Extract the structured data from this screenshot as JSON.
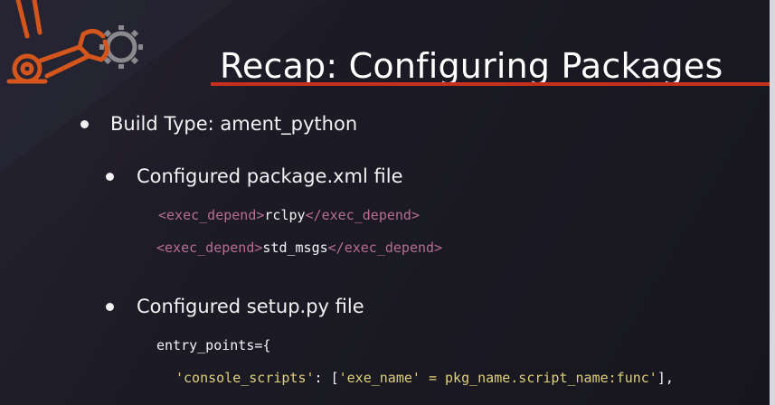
{
  "slide": {
    "title": "Recap: Configuring Packages",
    "accent_color": "#c6311f",
    "logo_icon": "robot-arm-gear-icon"
  },
  "bullets": [
    {
      "text": "Build Type: ament_python"
    },
    {
      "text": "Configured package.xml file"
    },
    {
      "text": "Configured setup.py file"
    }
  ],
  "package_xml": [
    {
      "open_tag": "<exec_depend>",
      "value": "rclpy",
      "close_tag": "</exec_depend>"
    },
    {
      "open_tag": "<exec_depend>",
      "value": "std_msgs",
      "close_tag": "</exec_depend>"
    }
  ],
  "setup_py": {
    "line1": "entry_points={",
    "key": "'console_scripts'",
    "sep": ": [",
    "entry": "'exe_name' = pkg_name.script_name:func'",
    "end": "],"
  }
}
